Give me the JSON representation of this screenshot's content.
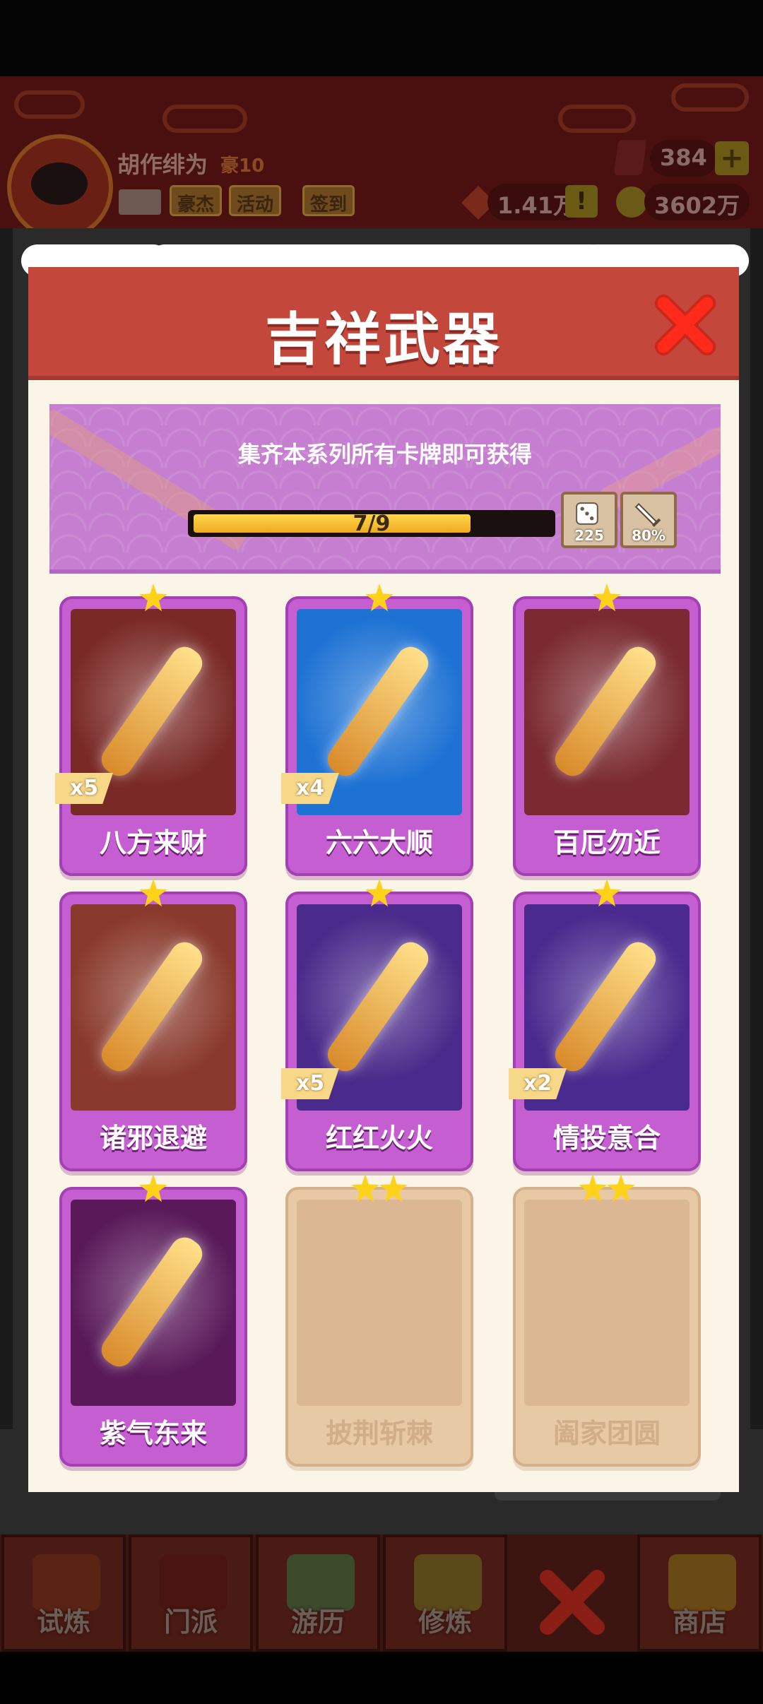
{
  "player": {
    "name": "胡作绯为",
    "rank": "豪10",
    "chips": [
      "豪杰",
      "活动",
      "签到"
    ],
    "gems": "384",
    "red_resource": "1.41万",
    "coins": "3602万",
    "alert": "!",
    "plus": "+"
  },
  "nav": {
    "items": [
      "试炼",
      "门派",
      "游历",
      "修炼",
      "商店"
    ]
  },
  "modal": {
    "title": "吉祥武器",
    "banner_text": "集齐本系列所有卡牌即可获得",
    "progress": {
      "text": "7/9",
      "value": 7,
      "max": 9
    },
    "rewards": [
      {
        "icon": "dice-icon",
        "label": "225"
      },
      {
        "icon": "sword-icon",
        "label": "80%"
      }
    ]
  },
  "cards": [
    {
      "name": "八方来财",
      "count": "x5",
      "stars": 1,
      "locked": false,
      "theme": "#7a2a26"
    },
    {
      "name": "六六大顺",
      "count": "x4",
      "stars": 1,
      "locked": false,
      "theme": "#1e72d4"
    },
    {
      "name": "百厄勿近",
      "count": "",
      "stars": 1,
      "locked": false,
      "theme": "#7a2a30"
    },
    {
      "name": "诸邪退避",
      "count": "",
      "stars": 1,
      "locked": false,
      "theme": "#8a3a2c"
    },
    {
      "name": "红红火火",
      "count": "x5",
      "stars": 1,
      "locked": false,
      "theme": "#4a2a8a"
    },
    {
      "name": "情投意合",
      "count": "x2",
      "stars": 1,
      "locked": false,
      "theme": "#4a2a8e"
    },
    {
      "name": "紫气东来",
      "count": "",
      "stars": 1,
      "locked": false,
      "theme": "#5a1a5a"
    },
    {
      "name": "披荆斩棘",
      "count": "",
      "stars": 2,
      "locked": true,
      "theme": "#dcb793"
    },
    {
      "name": "阖家团圆",
      "count": "",
      "stars": 2,
      "locked": true,
      "theme": "#dcb793"
    }
  ],
  "colors": {
    "header_red": "#c4473c",
    "card_purple": "#c45ed1",
    "locked_tan": "#e7c9a6",
    "star_gold": "#ffd21a",
    "progress_gold": "#f0a820"
  }
}
